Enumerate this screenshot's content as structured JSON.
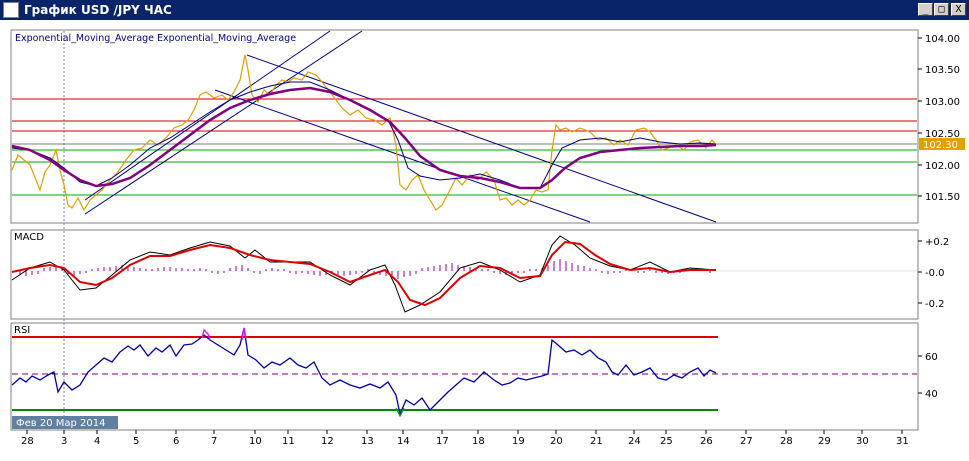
{
  "window": {
    "title": "График USD /JPY ЧАС",
    "minimize": "_",
    "restore": "□",
    "close": "X"
  },
  "colors": {
    "price": "#e0a000",
    "ema_fast": "#000080",
    "ema_slow": "#800080",
    "channel": "#000080",
    "resistance": "#cc0000",
    "support": "#00aa00",
    "macd_main": "#000000",
    "macd_signal": "#dd0000",
    "macd_hist": "#990099",
    "rsi_line": "#0000aa",
    "rsi_upper": "#dd0000",
    "rsi_lower": "#008800",
    "price_tag_bg": "#e0a000"
  },
  "main_panel": {
    "legend": "Exponential_Moving_Average Exponential_Moving_Average",
    "price_tag": "102.30",
    "y_ticks": [
      "104.00",
      "103.50",
      "103.00",
      "102.50",
      "102.00",
      "101.50"
    ]
  },
  "macd_panel": {
    "label": "MACD",
    "y_ticks": [
      "+0.2",
      "-0.0",
      "-0.2"
    ]
  },
  "rsi_panel": {
    "label": "RSI",
    "y_ticks": [
      "60",
      "40"
    ]
  },
  "x_axis": {
    "labels": [
      "28",
      "3",
      "4",
      "5",
      "6",
      "7",
      "10",
      "11",
      "12",
      "13",
      "14",
      "17",
      "18",
      "19",
      "20",
      "21",
      "24",
      "25",
      "26",
      "27",
      "28",
      "29",
      "30",
      "31"
    ],
    "period_label": "Фев 20  Мар 2014"
  },
  "chart_data": {
    "type": "line",
    "title": "",
    "price_axis": [
      101.5,
      104.0
    ],
    "resistance_levels": [
      103.0,
      102.65,
      102.5
    ],
    "support_levels": [
      102.2,
      102.0,
      101.5
    ],
    "rsi_levels": [
      70,
      50,
      30
    ],
    "price_series": [
      {
        "x": "28",
        "y": 102.2
      },
      {
        "x": "3",
        "y": 101.8
      },
      {
        "x": "4",
        "y": 101.5
      },
      {
        "x": "5",
        "y": 102.0
      },
      {
        "x": "6",
        "y": 102.6
      },
      {
        "x": "7",
        "y": 103.0
      },
      {
        "x": "10",
        "y": 103.6
      },
      {
        "x": "11",
        "y": 103.3
      },
      {
        "x": "12",
        "y": 103.2
      },
      {
        "x": "13",
        "y": 102.8
      },
      {
        "x": "14",
        "y": 101.9
      },
      {
        "x": "17",
        "y": 101.7
      },
      {
        "x": "18",
        "y": 101.9
      },
      {
        "x": "19",
        "y": 101.5
      },
      {
        "x": "20",
        "y": 102.5
      },
      {
        "x": "21",
        "y": 102.4
      },
      {
        "x": "24",
        "y": 102.5
      },
      {
        "x": "25",
        "y": 102.3
      },
      {
        "x": "26",
        "y": 102.3
      }
    ]
  }
}
